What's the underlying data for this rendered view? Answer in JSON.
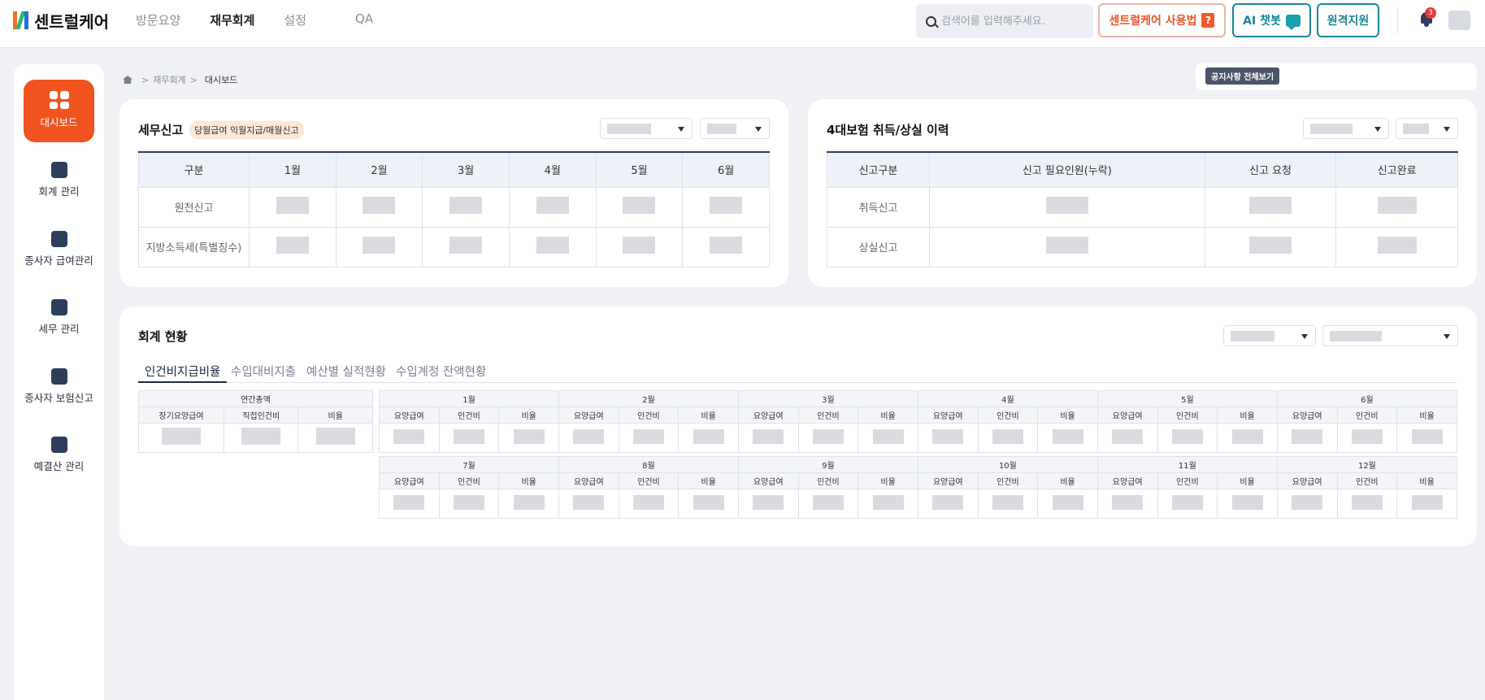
{
  "header": {
    "logo_text": "센트럴케어",
    "nav": [
      "방문요양",
      "재무회계",
      "설정",
      "QA"
    ],
    "active_nav": "재무회계",
    "search_placeholder": "검색어를 입력해주세요.",
    "guide_label": "센트럴케어 사용법",
    "guide_icon_text": "?",
    "ai_label": "AI 챗봇",
    "remote_label": "원격지원",
    "notification_count": "3"
  },
  "sidebar": {
    "items": [
      "대시보드",
      "회계 관리",
      "종사자 급여관리",
      "세무 관리",
      "종사자 보험신고",
      "예결산 관리"
    ],
    "active": "대시보드"
  },
  "breadcrumb": {
    "items": [
      "재무회계",
      "대시보드"
    ],
    "sep": ">"
  },
  "notice": {
    "label": "공지사항 전체보기"
  },
  "tax_card": {
    "title": "세무신고",
    "tag": "당월급여 익월지급/매월신고",
    "columns": [
      "구분",
      "1월",
      "2월",
      "3월",
      "4월",
      "5월",
      "6월"
    ],
    "rows": [
      "원천신고",
      "지방소득세(특별징수)"
    ]
  },
  "insurance_card": {
    "title": "4대보험 취득/상실 이력",
    "columns": [
      "신고구분",
      "신고 필요인원(누락)",
      "신고 요청",
      "신고완료"
    ],
    "rows": [
      "취득신고",
      "상실신고"
    ]
  },
  "accounting_card": {
    "title": "회계 현황",
    "tabs": [
      "인건비지급비율",
      "수입대비지출",
      "예산별 실적현황",
      "수입계정 잔액현황"
    ],
    "annual": {
      "title": "연간총액",
      "columns": [
        "장기요양급여",
        "직접인건비",
        "비율"
      ]
    },
    "months_first": [
      "1월",
      "2월",
      "3월",
      "4월",
      "5월",
      "6월"
    ],
    "months_second": [
      "7월",
      "8월",
      "9월",
      "10월",
      "11월",
      "12월"
    ],
    "sub_columns": [
      "요양급여",
      "인건비",
      "비율"
    ]
  },
  "colors": {
    "accent": "#f0531e",
    "teal": "#19869a",
    "navy": "#2d3d5c"
  }
}
